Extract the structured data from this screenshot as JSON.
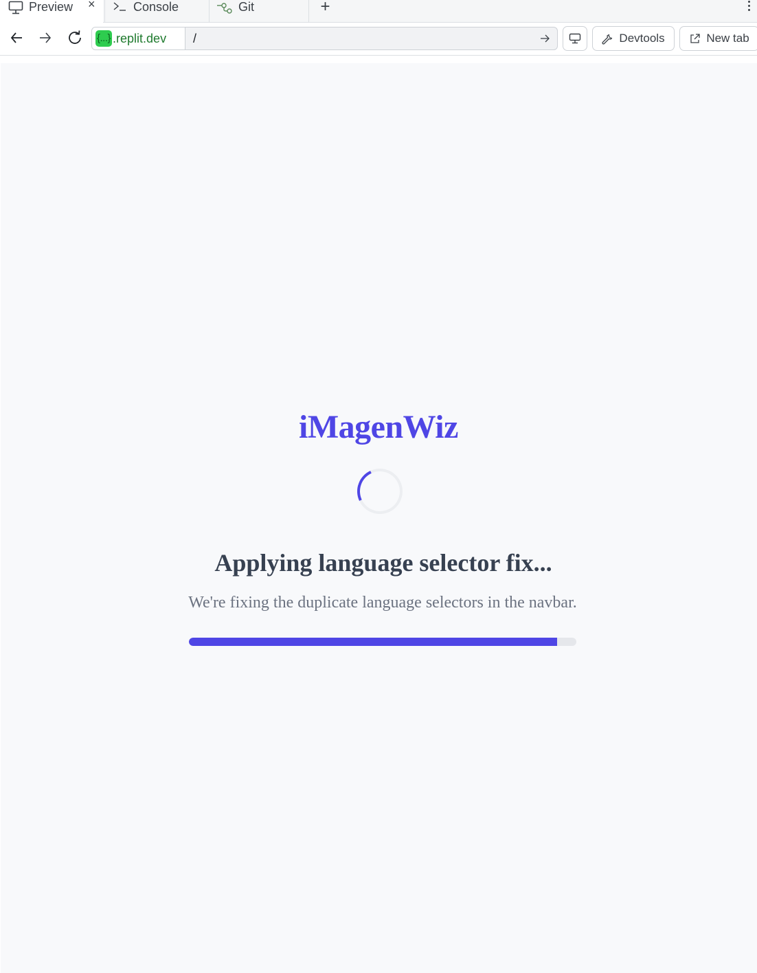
{
  "tabs": {
    "preview": {
      "label": "Preview",
      "icon": "monitor-icon"
    },
    "console": {
      "label": "Console",
      "icon": "terminal-icon"
    },
    "git": {
      "label": "Git",
      "icon": "git-branch-icon"
    },
    "close_glyph": "×",
    "add_glyph": "+"
  },
  "address_bar": {
    "host_pill": "{...}",
    "domain": ".replit.dev",
    "path": "/"
  },
  "toolbar": {
    "devtools_label": "Devtools",
    "newtab_label": "New tab"
  },
  "page": {
    "brand": "iMagenWiz",
    "heading": "Applying language selector fix...",
    "subtext": "We're fixing the duplicate language selectors in the navbar.",
    "progress": 0.95
  },
  "colors": {
    "accent": "#4f46e5",
    "url_pill": "#2ecc4f",
    "heading": "#374151",
    "subtext": "#6b7280"
  }
}
